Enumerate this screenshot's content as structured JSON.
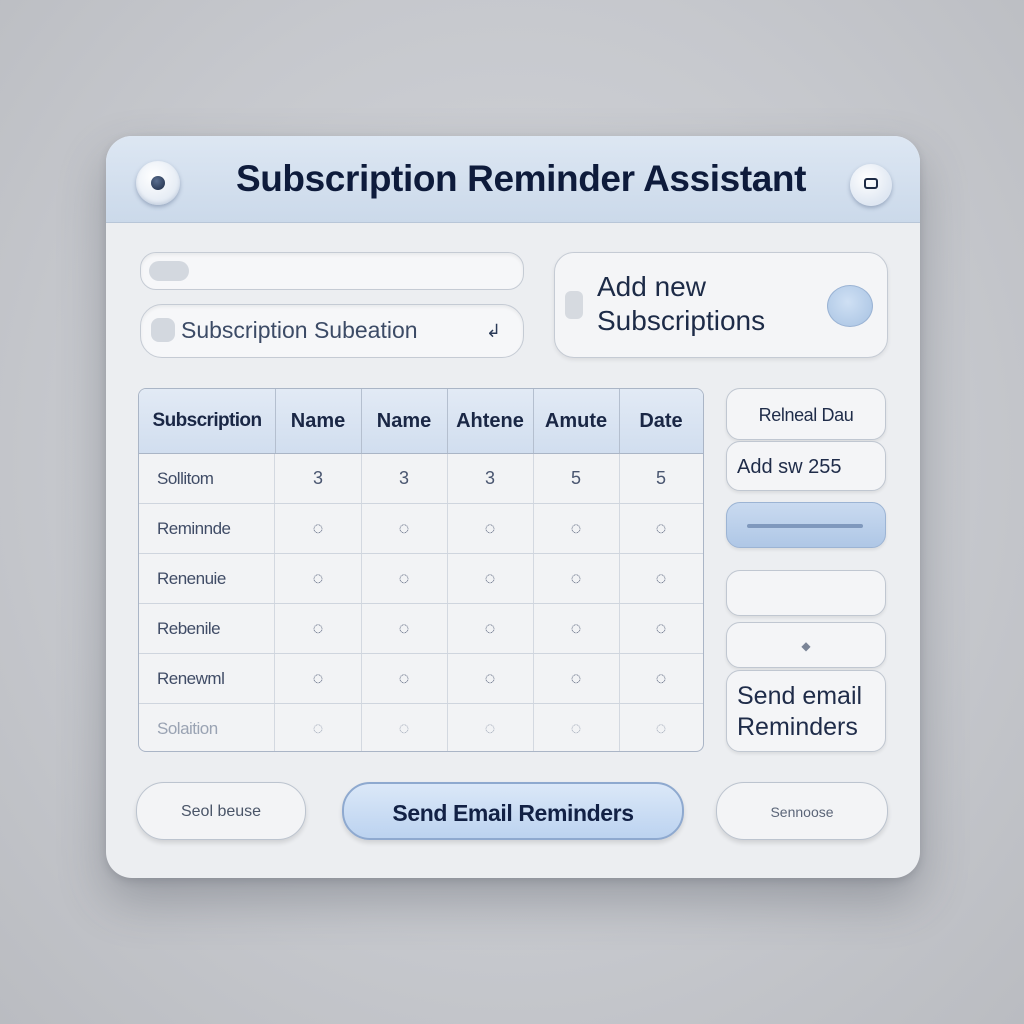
{
  "window": {
    "title": "Subscription Reminder Assistant"
  },
  "search": {
    "field_text": "Subscription Subeation"
  },
  "add_card": {
    "line1": "Add new",
    "line2": "Subscriptions"
  },
  "table": {
    "headers": [
      "Subscription",
      "Name",
      "Name",
      "Ahtene",
      "Amute",
      "Date"
    ],
    "rows": [
      {
        "label": "Sollitom",
        "cells": [
          "3",
          "3",
          "3",
          "5",
          "5"
        ]
      },
      {
        "label": "Reminnde",
        "cells": [
          "◌",
          "◌",
          "◌",
          "◌",
          "◌"
        ]
      },
      {
        "label": "Renenuie",
        "cells": [
          "◌",
          "◌",
          "◌",
          "◌",
          "◌"
        ]
      },
      {
        "label": "Rebenile",
        "cells": [
          "◌",
          "◌",
          "◌",
          "◌",
          "◌"
        ]
      },
      {
        "label": "Renewml",
        "cells": [
          "◌",
          "◌",
          "◌",
          "◌",
          "◌"
        ]
      },
      {
        "label": "Solaition",
        "cells": [
          "◌",
          "◌",
          "◌",
          "◌",
          "◌"
        ]
      }
    ]
  },
  "side": {
    "renewal_label": "Relneal Dau",
    "add_label": "Add sw 255",
    "blank_label": "◆",
    "send_line1": "Send email",
    "send_line2": "Reminders"
  },
  "footer": {
    "left_label": "Seol beuse",
    "main_label": "Send Email Reminders",
    "right_label": "Sennoose"
  },
  "colors": {
    "accent": "#bcd3f0",
    "titlebar": "#cbd9ea",
    "text": "#0e1b3b"
  }
}
